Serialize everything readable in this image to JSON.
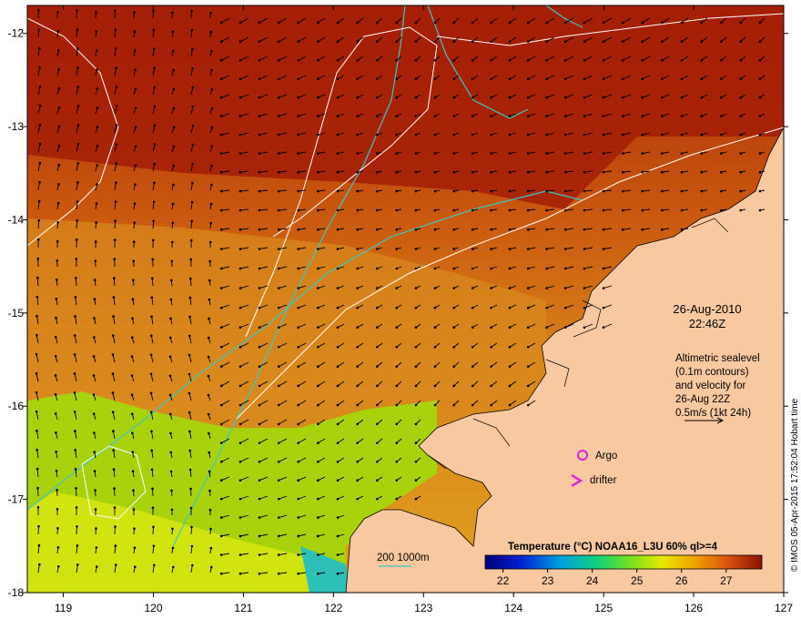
{
  "axes": {
    "x_ticks": [
      "119",
      "120",
      "121",
      "122",
      "123",
      "124",
      "125",
      "126",
      "127"
    ],
    "y_ticks": [
      "-12",
      "-13",
      "-14",
      "-15",
      "-16",
      "-17",
      "-18"
    ],
    "x_range": [
      118.6,
      127.0
    ],
    "y_range": [
      -11.7,
      -18.0
    ]
  },
  "timestamp": {
    "date": "26-Aug-2010",
    "time": "22:46Z"
  },
  "info_lines": [
    "Altimetric sealevel",
    "(0.1m contours)",
    "and velocity for",
    "26-Aug 22Z",
    "0.5m/s (1kt 24h)"
  ],
  "legend": {
    "argo": "Argo",
    "drifter": "drifter",
    "isobath": "200  1000m"
  },
  "colorbar": {
    "title": "Temperature (°C) NOAA16_L3U 60% ql>=4",
    "ticks": [
      "22",
      "23",
      "24",
      "25",
      "26",
      "27"
    ],
    "range": [
      21.6,
      27.8
    ]
  },
  "credit": "© IMOS 05-Apr-2015 17:52:04 Hobart time",
  "colors": {
    "land": "#f8c9a0",
    "sst_warm": "#9c1a05",
    "sst_mid": "#d66a10",
    "sst_cool": "#c8e60c",
    "isobath": "#3fc6c0",
    "argo": "#e020e0"
  }
}
